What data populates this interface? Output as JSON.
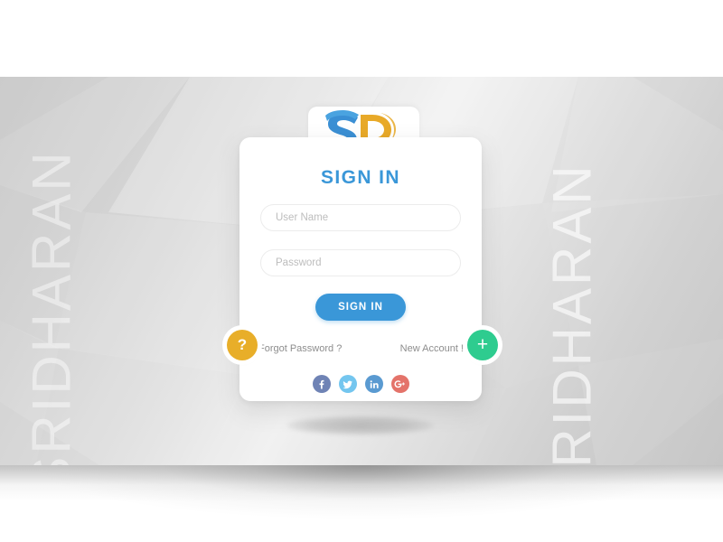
{
  "brand": {
    "name": "SRIDHARAN",
    "logo_letters": "SD",
    "logo_blue": "#3a97d8",
    "logo_orange": "#e8a928"
  },
  "background": {
    "watermark_left_text": "SRIDHARAN",
    "watermark_right_text": "SRIDHARAN"
  },
  "card": {
    "title": "SIGN IN",
    "title_color": "#3a97d8",
    "username": {
      "placeholder": "User Name",
      "value": ""
    },
    "password": {
      "placeholder": "Password",
      "value": ""
    },
    "submit": {
      "label": "SIGN IN",
      "color": "#3a97d8"
    },
    "links": {
      "forgot_password": "Forgot Password ?",
      "new_account": "New Account !"
    },
    "badges": {
      "help": {
        "glyph": "?",
        "color": "#e8ae29",
        "name": "help-badge"
      },
      "add": {
        "glyph": "+",
        "color": "#2ecc8f",
        "name": "add-account-badge"
      }
    },
    "social": [
      {
        "name": "facebook-icon",
        "label": "f",
        "color": "#6f83b5"
      },
      {
        "name": "twitter-icon",
        "label": "t",
        "color": "#74c6ef"
      },
      {
        "name": "linkedin-icon",
        "label": "in",
        "color": "#5a9ad1"
      },
      {
        "name": "googleplus-icon",
        "label": "g+",
        "color": "#e4736a"
      }
    ]
  }
}
